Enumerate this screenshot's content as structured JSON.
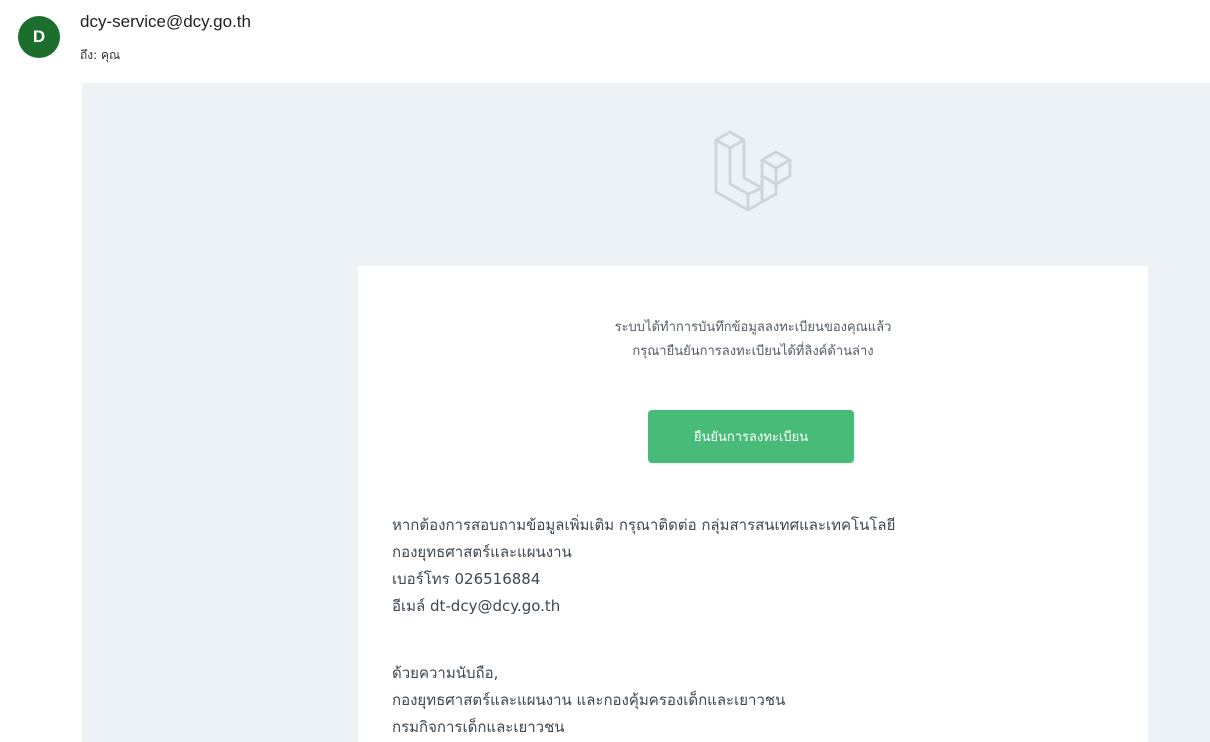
{
  "header": {
    "avatar_letter": "D",
    "sender": "dcy-service@dcy.go.th",
    "to_line": "ถึง: คุณ"
  },
  "email": {
    "logo_icon": "laravel-logo-icon",
    "intro_lines": [
      "ระบบได้ทำการบันทึกข้อมูลลงทะเบียนของคุณแล้ว",
      "กรุณายืนยันการลงทะเบียนได้ที่ลิงค์ด้านล่าง"
    ],
    "confirm_button_label": "ยืนยันการลงทะเบียน",
    "contact_lines": [
      "หากต้องการสอบถามข้อมูลเพิ่มเติม กรุณาติดต่อ กลุ่มสารสนเทศและเทคโนโลยี",
      "กองยุทธศาสตร์และแผนงาน",
      "เบอร์โทร 026516884",
      "อีเมล์ dt-dcy@dcy.go.th"
    ],
    "signoff_lines": [
      "ด้วยความนับถือ,",
      "กองยุทธศาสตร์และแผนงาน และกองคุ้มครองเด็กและเยาวชน",
      "กรมกิจการเด็กและเยาวชน"
    ]
  },
  "colors": {
    "avatar_bg": "#1b6e2c",
    "email_bg": "#edf2f7",
    "button_bg": "#48bb78",
    "text": "#3d4852"
  }
}
